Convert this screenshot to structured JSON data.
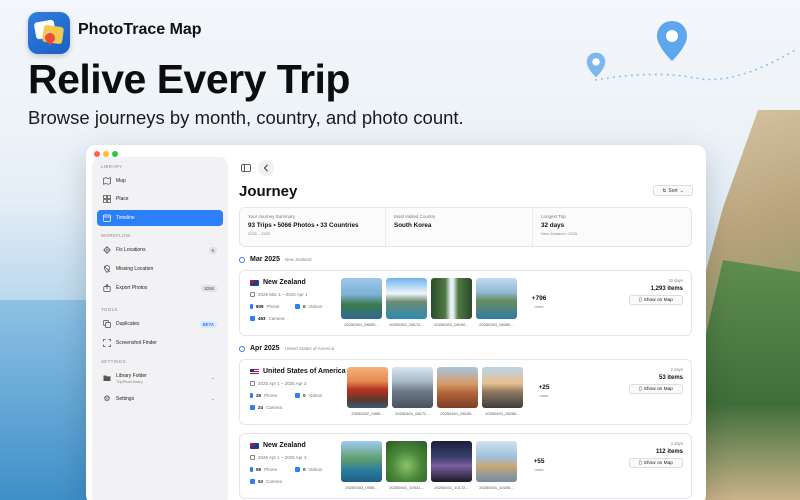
{
  "header": {
    "app_name": "PhotoTrace Map",
    "headline": "Relive Every Trip",
    "subheadline": "Browse journeys by month, country, and photo count."
  },
  "colors": {
    "accent": "#2d7ff9",
    "traffic_red": "#ff5f57",
    "traffic_yellow": "#febc2e",
    "traffic_green": "#28c840"
  },
  "sidebar": {
    "library_header": "LIBRARY",
    "workflow_header": "WORKFLOW",
    "tools_header": "TOOLS",
    "settings_header": "SETTINGS",
    "items": {
      "map": {
        "label": "Map",
        "icon": "map-icon"
      },
      "place": {
        "label": "Place",
        "icon": "grid-icon"
      },
      "timeline": {
        "label": "Timeline",
        "icon": "calendar-icon"
      },
      "fix_locations": {
        "label": "Fix Locations",
        "badge": "5",
        "icon": "crosshair-icon"
      },
      "missing_location": {
        "label": "Missing Location",
        "icon": "location-slash-icon"
      },
      "export_photos": {
        "label": "Export Photos",
        "badge": "8286",
        "icon": "export-icon"
      },
      "duplicates": {
        "label": "Duplicates",
        "badge": "BETA",
        "icon": "duplicate-icon"
      },
      "screenshot_finder": {
        "label": "Screenshot Finder",
        "icon": "screenshot-icon"
      },
      "library_folder": {
        "label": "Library Folder",
        "sub": "TripPlusLibrary",
        "icon": "folder-icon"
      },
      "settings": {
        "label": "Settings",
        "icon": "gear-icon"
      }
    }
  },
  "main": {
    "title": "Journey",
    "sort_label": "Sort",
    "summary": {
      "your_summary_label": "Your Journey Summary",
      "your_summary_value": "93 Trips • 5066 Photos • 33 Countries",
      "your_summary_sub": "2025 – 2025",
      "most_visited_label": "Most Visited Country",
      "most_visited_value": "South Korea",
      "longest_label": "Longest Trip",
      "longest_value": "32 days",
      "longest_sub": "New Zealand • 2025"
    },
    "months": [
      {
        "label": "Mar 2025",
        "country": "New Zealand"
      },
      {
        "label": "Apr 2025",
        "country": "United States of America"
      }
    ],
    "cards": [
      {
        "name": "New Zealand",
        "dates": "2025 Mar 1 – 2025 Apr 1",
        "phone_count": "809",
        "phone_label": "Phone",
        "video_count": "0",
        "video_label": "Videos",
        "camera_count": "493",
        "camera_label": "Camera",
        "captions": [
          "20250301_08090...",
          "20250301_08172...",
          "20250301_08190...",
          "20250301_08280..."
        ],
        "more_count": "+796",
        "more_label": "more",
        "days": "32 days",
        "items": "1,293 items",
        "show_map": "Show on Map"
      },
      {
        "name": "United States of America",
        "dates": "2025 Apr 1 – 2025 Apr 2",
        "phone_count": "29",
        "phone_label": "Phone",
        "video_count": "0",
        "video_label": "Videos",
        "camera_count": "24",
        "camera_label": "Camera",
        "captions": [
          "20250402_0950...",
          "20250401_08172...",
          "20250401_08190...",
          "20250401_08280..."
        ],
        "more_count": "+25",
        "more_label": "more",
        "days": "2 days",
        "items": "53 items",
        "show_map": "Show on Map"
      },
      {
        "name": "New Zealand",
        "dates": "2025 Apr 1 – 2025 Apr 3",
        "phone_count": "59",
        "phone_label": "Phone",
        "video_count": "0",
        "video_label": "Videos",
        "camera_count": "53",
        "camera_label": "Camera",
        "captions": [
          "20250403_0955...",
          "20250401_10031...",
          "20250401_10172...",
          "20250401_10205..."
        ],
        "more_count": "+55",
        "more_label": "more",
        "days": "3 days",
        "items": "112 items",
        "show_map": "Show on Map"
      }
    ]
  }
}
